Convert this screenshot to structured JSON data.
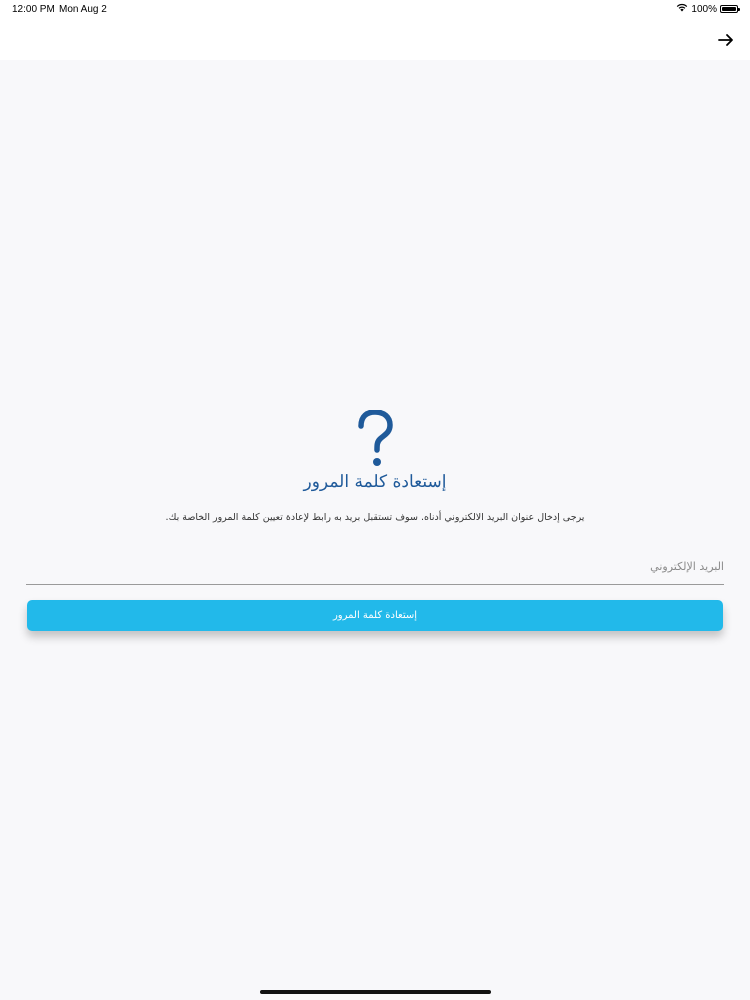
{
  "status_bar": {
    "time": "12:00 PM",
    "date": "Mon Aug 2",
    "battery": "100%",
    "icons": [
      "wifi-icon",
      "battery-icon"
    ]
  },
  "nav": {
    "icon": "arrow-right-icon"
  },
  "reset": {
    "icon": "question-mark-icon",
    "title": "إستعادة كلمة المرور",
    "instructions": "يرجى إدخال عنوان البريد الالكتروني أدناه. سوف تستقبل بريد به رابط لإعادة تعيين كلمة المرور الخاصة بك.",
    "email_placeholder": "البريد الإلكتروني",
    "email_value": "",
    "submit_label": "إستعادة كلمة المرور"
  },
  "colors": {
    "title": "#1f5a9a",
    "button": "#22b9ea",
    "icon": "#1f5a9a"
  }
}
